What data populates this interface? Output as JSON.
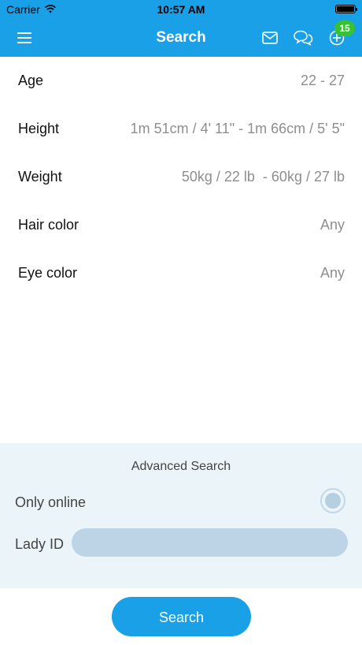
{
  "status_bar": {
    "carrier": "Carrier",
    "time": "10:57 AM"
  },
  "navbar": {
    "title": "Search",
    "notification_count": "15"
  },
  "filters": [
    {
      "label": "Age",
      "value": "22 - 27"
    },
    {
      "label": "Height",
      "value": "1m 51cm / 4' 11\" - 1m 66cm / 5' 5\""
    },
    {
      "label": "Weight",
      "value": "50kg / 22 lb  - 60kg / 27 lb"
    },
    {
      "label": "Hair color",
      "value": "Any"
    },
    {
      "label": "Eye color",
      "value": "Any"
    }
  ],
  "advanced": {
    "title": "Advanced Search",
    "only_online_label": "Only online",
    "lady_id_label": "Lady ID",
    "lady_id_value": ""
  },
  "search_button": "Search",
  "colors": {
    "primary": "#1aa0e6",
    "badge": "#37c234",
    "advanced_bg": "#eaf4f9"
  },
  "icons": [
    "menu-icon",
    "wifi-icon",
    "battery-icon",
    "mail-icon",
    "chat-icon",
    "plus-circle-icon"
  ]
}
